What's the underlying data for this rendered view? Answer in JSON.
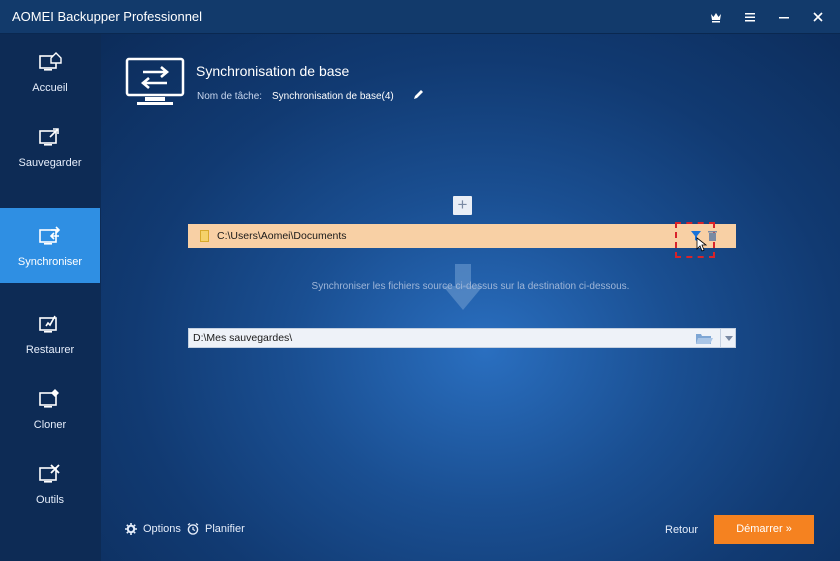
{
  "window": {
    "title": "AOMEI Backupper Professionnel"
  },
  "sidebar": {
    "items": [
      {
        "label": "Accueil",
        "icon": "home-icon",
        "active": false
      },
      {
        "label": "Sauvegarder",
        "icon": "backup-icon",
        "active": false
      },
      {
        "label": "Synchroniser",
        "icon": "sync-icon",
        "active": true
      },
      {
        "label": "Restaurer",
        "icon": "restore-icon",
        "active": false
      },
      {
        "label": "Cloner",
        "icon": "clone-icon",
        "active": false
      },
      {
        "label": "Outils",
        "icon": "tools-icon",
        "active": false
      }
    ]
  },
  "task": {
    "title": "Synchronisation de base",
    "name_label": "Nom de tâche:",
    "name_value": "Synchronisation de base(4)"
  },
  "source": {
    "path": "C:\\Users\\Aomei\\Documents"
  },
  "description": "Synchroniser les fichiers source ci-dessus sur la destination ci-dessous.",
  "destination": {
    "path": "D:\\Mes sauvegardes\\"
  },
  "footer": {
    "options_label": "Options",
    "schedule_label": "Planifier",
    "back_label": "Retour",
    "start_label": "Démarrer »"
  },
  "colors": {
    "accent": "#2f8fe3",
    "start_button": "#f58220",
    "source_bar": "#f8d0a5",
    "highlight": "#d8232a"
  }
}
